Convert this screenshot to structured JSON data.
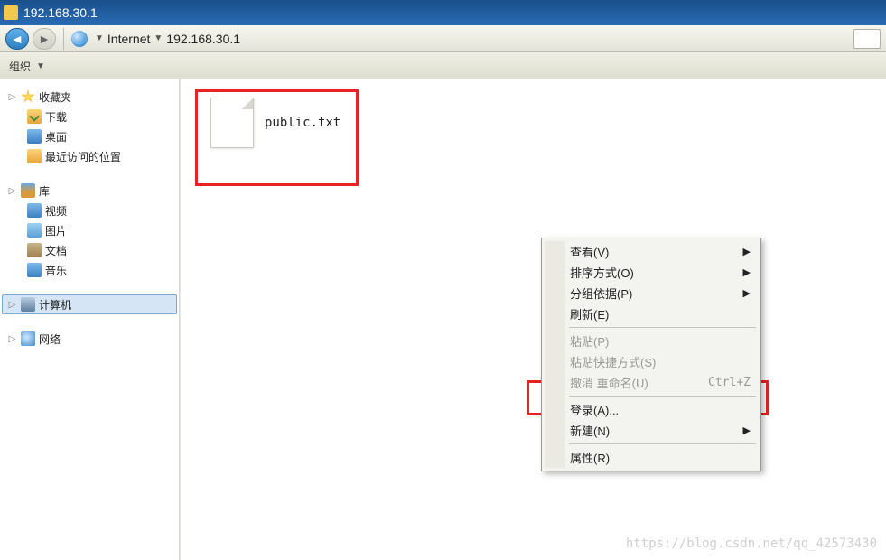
{
  "title": "192.168.30.1",
  "nav": {
    "segment1": "Internet",
    "segment2": "192.168.30.1"
  },
  "toolbar": {
    "organize": "组织"
  },
  "sidebar": {
    "favorites": {
      "label": "收藏夹",
      "children": [
        {
          "label": "下载",
          "icon": "i-dl"
        },
        {
          "label": "桌面",
          "icon": "i-desk"
        },
        {
          "label": "最近访问的位置",
          "icon": "i-rec"
        }
      ]
    },
    "libraries": {
      "label": "库",
      "children": [
        {
          "label": "视频",
          "icon": "i-vid"
        },
        {
          "label": "图片",
          "icon": "i-pic"
        },
        {
          "label": "文档",
          "icon": "i-doc"
        },
        {
          "label": "音乐",
          "icon": "i-mus"
        }
      ]
    },
    "computer": {
      "label": "计算机"
    },
    "network": {
      "label": "网络"
    }
  },
  "file": {
    "name": "public.txt"
  },
  "context_menu": {
    "view": "查看(V)",
    "sort": "排序方式(O)",
    "group": "分组依据(P)",
    "refresh": "刷新(E)",
    "paste": "粘贴(P)",
    "paste_sc": "粘贴快捷方式(S)",
    "undo": "撤消 重命名(U)",
    "undo_key": "Ctrl+Z",
    "login": "登录(A)...",
    "new": "新建(N)",
    "props": "属性(R)"
  },
  "watermark": "https://blog.csdn.net/qq_42573430"
}
